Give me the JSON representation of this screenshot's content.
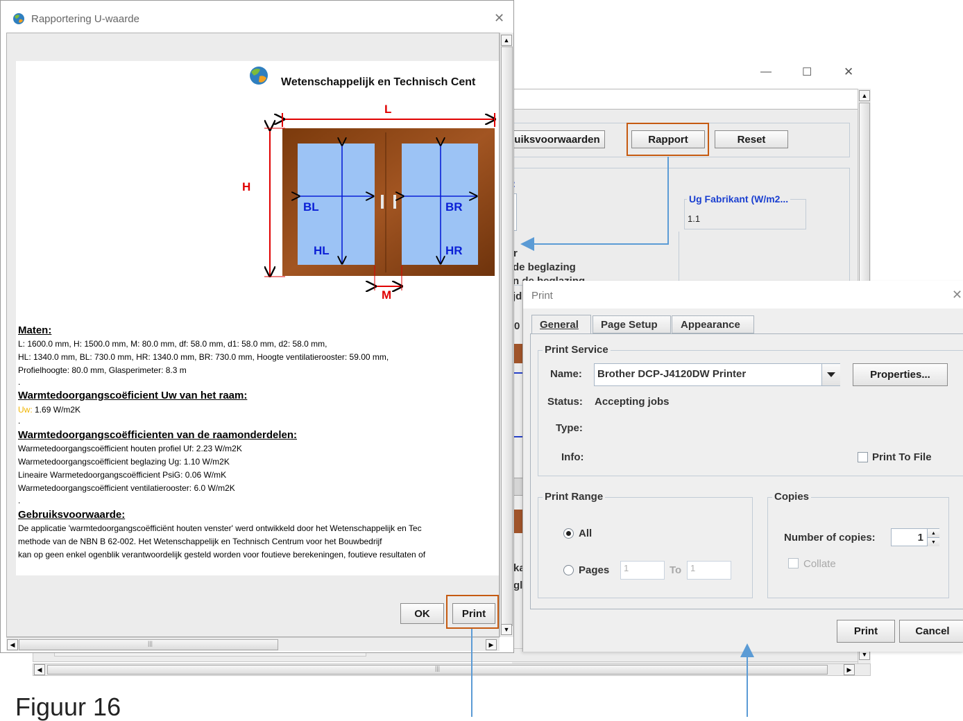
{
  "rapport_window": {
    "title": "Rapportering U-waarde",
    "close_symbol": "✕",
    "org_name": "Wetenschappelijk en Technisch Cent",
    "diagram_labels": {
      "L": "L",
      "H": "H",
      "M": "M",
      "BL": "BL",
      "BR": "BR",
      "HL": "HL",
      "HR": "HR"
    },
    "sections": {
      "maten_title": "Maten:",
      "maten_lines": [
        "L: 1600.0 mm,  H: 1500.0 mm,  M: 80.0 mm,  df: 58.0 mm,  d1: 58.0 mm,  d2: 58.0 mm,",
        "HL: 1340.0 mm,  BL: 730.0 mm,  HR: 1340.0 mm,  BR: 730.0 mm,  Hoogte ventilatierooster: 59.00 mm,",
        "Profielhoogte: 80.0 mm,  Glasperimeter: 8.3  m"
      ],
      "uw_title": "Warmtedoorgangscoëficient Uw van het raam:",
      "uw_label": "Uw:",
      "uw_value": " 1.69  W/m2K",
      "onderdelen_title": "Warmtedoorgangscoëfficienten van de raamonderdelen:",
      "onderdelen_lines": [
        "Warmetedoorgangscoëfficient houten profiel Uf: 2.23  W/m2K",
        "Warmetedoorgangscoëfficient beglazing Ug: 1.10  W/m2K",
        "Lineaire Warmetedoorgangscoëfficient  PsiG: 0.06  W/mK",
        "Warmetedoorgangscoëfficient ventilatierooster: 6.0  W/m2K"
      ],
      "gebruik_title": "Gebruiksvoorwaarde:",
      "gebruik_lines": [
        "De applicatie 'warmtedoorgangscoëfficiënt houten venster' werd ontwikkeld door het Wetenschappelijk en Tec",
        " methode van de NBN B 62-002. Het Wetenschappelijk en Technisch Centrum voor het Bouwbedrijf",
        "kan op geen enkel ogenblik verantwoordelijk gesteld worden voor foutieve berekeningen, foutieve resultaten of"
      ],
      "dot": "."
    },
    "ok_label": "OK",
    "print_label": "Print"
  },
  "main_window": {
    "minimize_symbol": "—",
    "maximize_symbol": "☐",
    "close_symbol": "✕",
    "btn_voorwaarden": "uiksvoorwaarden",
    "btn_rapport": "Rapport",
    "btn_reset": "Reset",
    "colon_fragment": ":",
    "ug_title": "Ug Fabrikant (W/m2...",
    "ug_value": "1.1",
    "frag_r": "r",
    "frag_beglazing1": "de beglazing",
    "frag_beglazing2": "n de beglazing",
    "frag_jid": "jd",
    "frag_0": "0",
    "frag_ka": "ka",
    "frag_gl": "gl"
  },
  "print_dialog": {
    "title": "Print",
    "close_symbol": "✕",
    "tabs": [
      {
        "label": "General",
        "mnemonic_index": 0,
        "active": true
      },
      {
        "label": "Page Setup",
        "mnemonic_index": 5,
        "active": false
      },
      {
        "label": "Appearance",
        "mnemonic_index": 0,
        "active": false
      }
    ],
    "print_service": {
      "legend": "Print Service",
      "name_label": "Name:",
      "printer": "Brother DCP-J4120DW Printer",
      "properties_label": "Properties...",
      "status_label": "Status:",
      "status_value": "Accepting jobs",
      "type_label": "Type:",
      "info_label": "Info:",
      "print_to_file_label": "Print To File"
    },
    "print_range": {
      "legend": "Print Range",
      "all_label": "All",
      "pages_label": "Pages",
      "from_value": "1",
      "to_label": "To",
      "to_value": "1",
      "selected": "All"
    },
    "copies": {
      "legend": "Copies",
      "number_label": "Number of copies:",
      "number_value": "1",
      "collate_label": "Collate"
    },
    "print_button": "Print",
    "cancel_button": "Cancel"
  },
  "caption": "Figuur 16",
  "colors": {
    "highlight_box": "#c55a11",
    "annotation_line": "#5b9bd5",
    "window_frame": "#8c4a12",
    "glass": "#9cc3f5",
    "dimension_red": "#e00000",
    "dimension_blue": "#0a1fd6",
    "uw_label": "#f0b400",
    "ug_title": "#1a3fd0"
  }
}
